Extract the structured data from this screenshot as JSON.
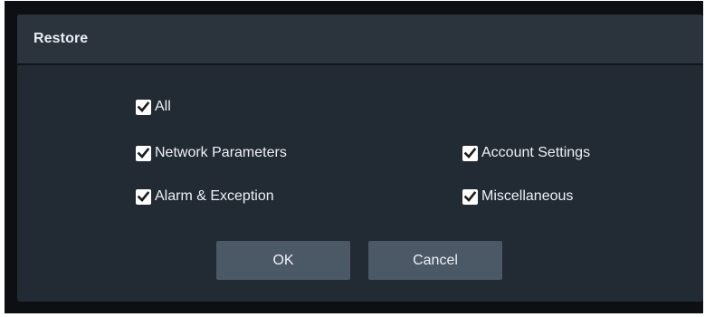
{
  "dialog": {
    "title": "Restore"
  },
  "options": {
    "all": {
      "label": "All",
      "checked": true
    },
    "network_parameters": {
      "label": "Network Parameters",
      "checked": true
    },
    "account_settings": {
      "label": "Account Settings",
      "checked": true
    },
    "alarm_exception": {
      "label": "Alarm & Exception",
      "checked": true
    },
    "miscellaneous": {
      "label": "Miscellaneous",
      "checked": true
    }
  },
  "buttons": {
    "ok_label": "OK",
    "cancel_label": "Cancel"
  },
  "colors": {
    "dialog_background": "#222a34",
    "header_background": "#2b333d",
    "button_background": "#4b5866",
    "text": "#eef2f6"
  }
}
